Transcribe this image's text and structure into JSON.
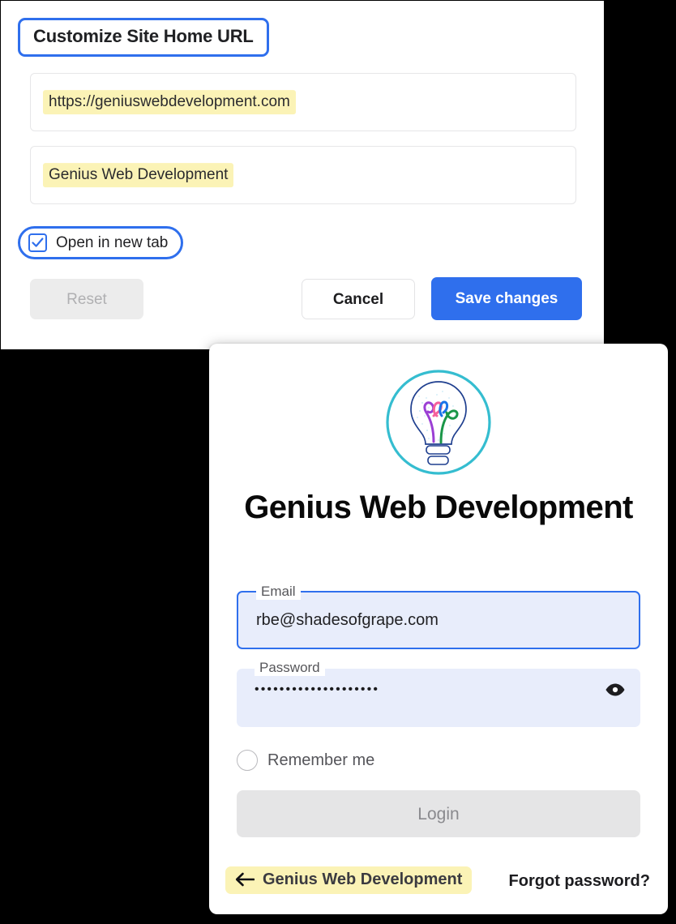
{
  "settings_dialog": {
    "title": "Customize Site Home URL",
    "url_field": {
      "value": "https://geniuswebdevelopment.com"
    },
    "name_field": {
      "value": "Genius Web Development"
    },
    "open_in_new_tab": {
      "label": "Open in new tab",
      "checked": true
    },
    "buttons": {
      "reset": "Reset",
      "cancel": "Cancel",
      "save": "Save changes"
    },
    "accent_color": "#2f6fed",
    "highlight_color": "#fbf3b6"
  },
  "login_card": {
    "logo": {
      "icon": "lightbulb-idea-logo",
      "ring_color": "#35bdd0",
      "bulb_outline_color": "#1f3f8f",
      "loop_colors": [
        "#9b3fd4",
        "#f5609c",
        "#1a73e8",
        "#1a9648"
      ]
    },
    "brand_title": "Genius Web Development",
    "email": {
      "label": "Email",
      "value": "rbe@shadesofgrape.com",
      "focused": true
    },
    "password": {
      "label": "Password",
      "value": "••••••••••••••••••••",
      "toggle_icon": "eye-icon"
    },
    "remember_me": {
      "label": "Remember me",
      "checked": false
    },
    "login_button": "Login",
    "back_link": {
      "icon": "arrow-left-icon",
      "label": "Genius Web Development"
    },
    "forgot_password": "Forgot password?",
    "field_fill_color": "#e8edfb",
    "highlight_color": "#fbf3b6"
  }
}
